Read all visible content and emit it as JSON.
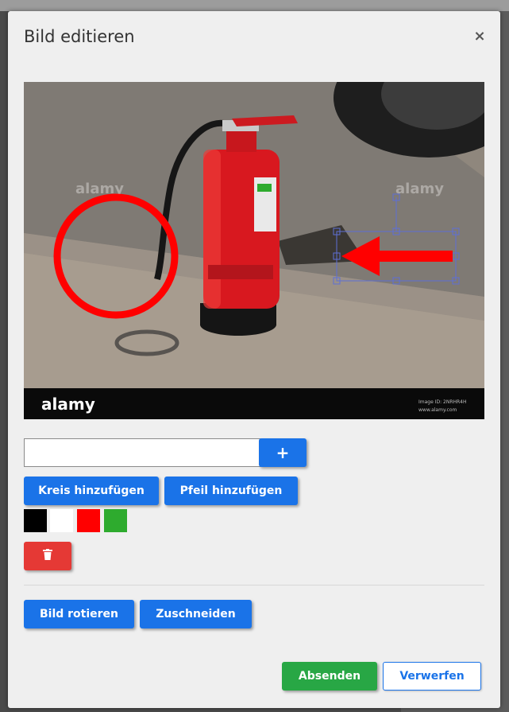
{
  "dialog": {
    "title": "Bild editieren",
    "close_symbol": "×"
  },
  "image": {
    "description_icon": "photo-fire-extinguisher",
    "watermark_brand": "alamy",
    "footer_right_line1": "Image ID: 2NRHR4H",
    "footer_right_line2": "www.alamy.com",
    "annotation_color": "#ff0000"
  },
  "text_tool": {
    "input_value": "",
    "input_placeholder": "",
    "add_label": "+"
  },
  "shape_tools": {
    "circle_label": "Kreis hinzufügen",
    "arrow_label": "Pfeil hinzufügen"
  },
  "colors": [
    {
      "name": "black",
      "value": "#000000"
    },
    {
      "name": "white",
      "value": "#ffffff"
    },
    {
      "name": "red",
      "value": "#ff0000"
    },
    {
      "name": "green",
      "value": "#2eab2e"
    }
  ],
  "delete_tool": {
    "icon": "trash-icon"
  },
  "transform_tools": {
    "rotate_label": "Bild rotieren",
    "crop_label": "Zuschneiden"
  },
  "footer": {
    "submit_label": "Absenden",
    "discard_label": "Verwerfen"
  },
  "theme": {
    "primary": "#1a73e8",
    "danger": "#e53935",
    "success": "#28a745",
    "modal_bg": "#efefef"
  }
}
